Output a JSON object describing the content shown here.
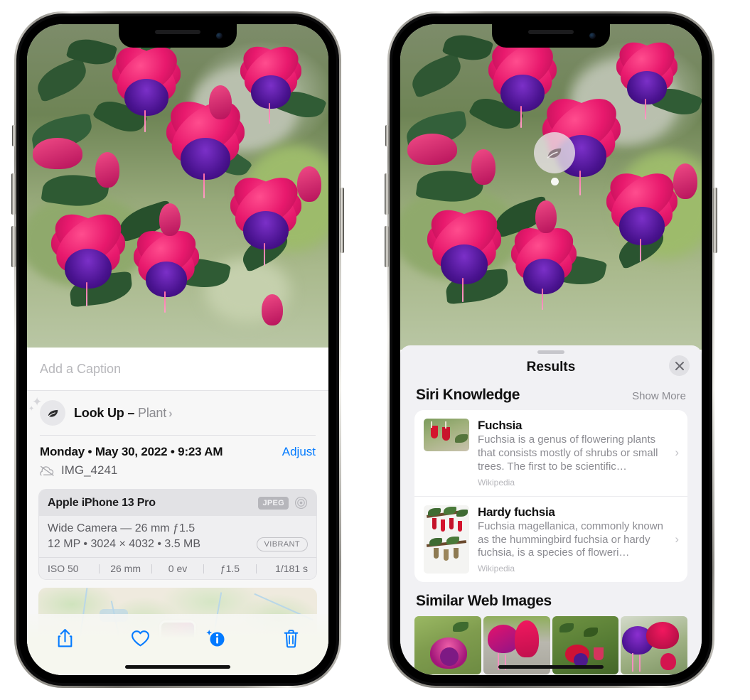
{
  "left_phone": {
    "caption_placeholder": "Add a Caption",
    "lookup": {
      "label": "Look Up –",
      "subject": "Plant",
      "icon": "leaf-icon",
      "chevron": "›"
    },
    "date": "Monday • May 30, 2022 • 9:23 AM",
    "adjust_label": "Adjust",
    "filename": "IMG_4241",
    "cloud_icon": "cloud-slash-icon",
    "exif": {
      "device": "Apple iPhone 13 Pro",
      "format_badge": "JPEG",
      "aperture_icon": "aperture-icon",
      "lens_line": "Wide Camera — 26 mm ƒ1.5",
      "specs_line": "12 MP • 3024 × 4032 • 3.5 MB",
      "style_badge": "VIBRANT",
      "stats": [
        "ISO 50",
        "26 mm",
        "0 ev",
        "ƒ1.5",
        "1/181 s"
      ]
    },
    "toolbar": [
      {
        "name": "share-button",
        "icon": "share-icon"
      },
      {
        "name": "favorite-button",
        "icon": "heart-icon"
      },
      {
        "name": "info-button",
        "icon": "info-sparkle-icon"
      },
      {
        "name": "delete-button",
        "icon": "trash-icon"
      }
    ],
    "accent_color": "#027aff"
  },
  "right_phone": {
    "visual_lookup_badge_icon": "leaf-icon",
    "sheet": {
      "title": "Results",
      "close_icon": "close-icon",
      "siri_knowledge": {
        "heading": "Siri Knowledge",
        "show_more": "Show More",
        "cards": [
          {
            "title": "Fuchsia",
            "description": "Fuchsia is a genus of flowering plants that consists mostly of shrubs or small trees. The first to be scientific…",
            "source": "Wikipedia",
            "chevron": "›"
          },
          {
            "title": "Hardy fuchsia",
            "description": "Fuchsia magellanica, commonly known as the hummingbird fuchsia or hardy fuchsia, is a species of floweri…",
            "source": "Wikipedia",
            "chevron": "›"
          }
        ]
      },
      "similar_web_images": {
        "heading": "Similar Web Images",
        "count": 4
      }
    }
  }
}
